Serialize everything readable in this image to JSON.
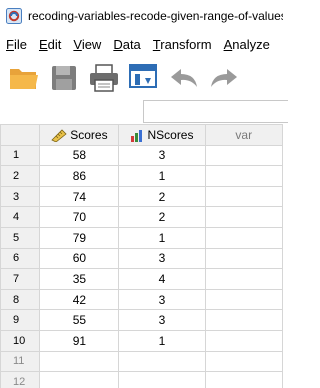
{
  "window": {
    "title": "recoding-variables-recode-given-range-of-values.sav"
  },
  "menu": [
    {
      "underline": "F",
      "rest": "ile"
    },
    {
      "underline": "E",
      "rest": "dit"
    },
    {
      "underline": "V",
      "rest": "iew"
    },
    {
      "underline": "D",
      "rest": "ata"
    },
    {
      "underline": "T",
      "rest": "ransform"
    },
    {
      "underline": "A",
      "rest": "nalyze"
    }
  ],
  "toolbar": {
    "buttons": [
      "open-folder-icon",
      "save-disk-icon",
      "print-icon",
      "recall-dialog-icon",
      "undo-icon",
      "redo-icon"
    ]
  },
  "grid": {
    "columns": [
      {
        "name": "Scores",
        "icon": "scale-ruler-icon"
      },
      {
        "name": "NScores",
        "icon": "ordinal-bars-icon"
      },
      {
        "name": "var",
        "icon": ""
      }
    ],
    "rows": [
      {
        "num": "1",
        "scores": "58",
        "nscores": "3"
      },
      {
        "num": "2",
        "scores": "86",
        "nscores": "1"
      },
      {
        "num": "3",
        "scores": "74",
        "nscores": "2"
      },
      {
        "num": "4",
        "scores": "70",
        "nscores": "2"
      },
      {
        "num": "5",
        "scores": "79",
        "nscores": "1"
      },
      {
        "num": "6",
        "scores": "60",
        "nscores": "3"
      },
      {
        "num": "7",
        "scores": "35",
        "nscores": "4"
      },
      {
        "num": "8",
        "scores": "42",
        "scores_dummy": "",
        "nscores": "3"
      },
      {
        "num": "9",
        "scores": "55",
        "nscores": "3"
      },
      {
        "num": "10",
        "scores": "91",
        "nscores": "1"
      }
    ],
    "empty_rows": [
      "11",
      "12"
    ]
  }
}
